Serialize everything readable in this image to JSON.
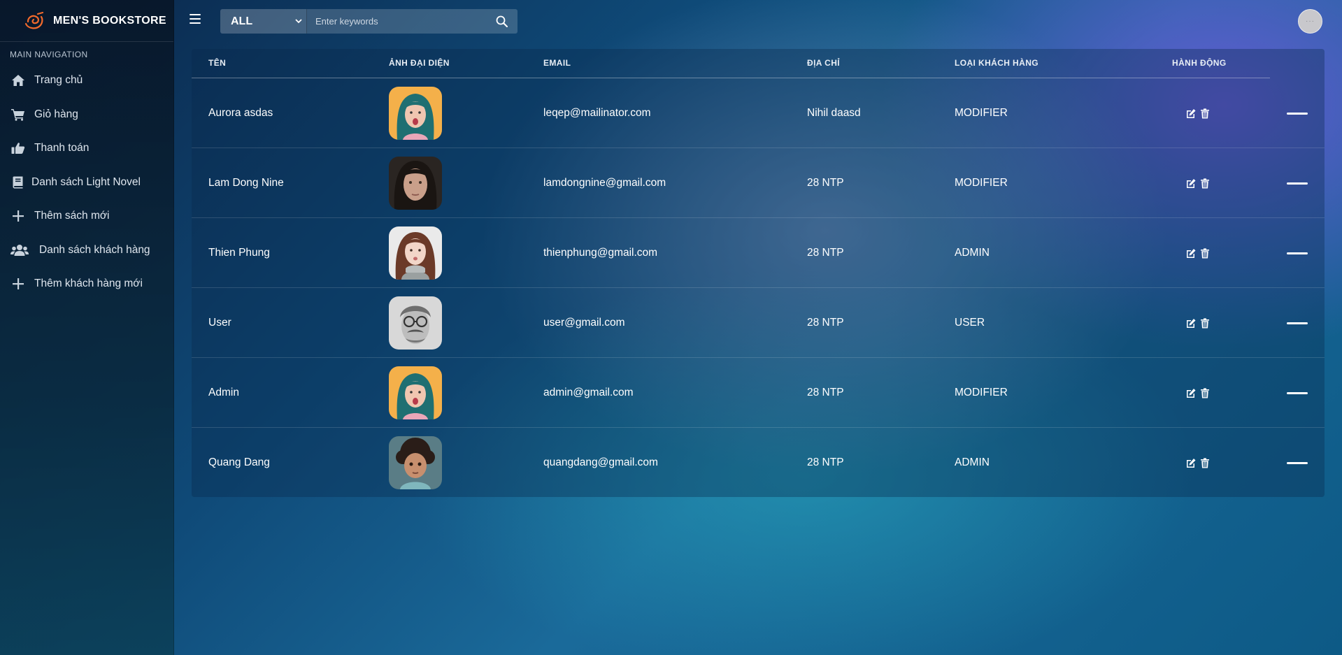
{
  "brand": {
    "title": "MEN'S BOOKSTORE",
    "logo_icon": "swirl-logo-icon",
    "accent": "#f26a2c"
  },
  "sidebar": {
    "header": "MAIN NAVIGATION",
    "items": [
      {
        "label": "Trang chủ",
        "icon": "home-icon"
      },
      {
        "label": "Giỏ hàng",
        "icon": "cart-icon"
      },
      {
        "label": "Thanh toán",
        "icon": "thumbs-up-icon"
      },
      {
        "label": "Danh sách Light Novel",
        "icon": "book-icon"
      },
      {
        "label": "Thêm sách mới",
        "icon": "plus-icon"
      },
      {
        "label": "Danh sách khách hàng",
        "icon": "users-icon"
      },
      {
        "label": "Thêm khách hàng mới",
        "icon": "plus-icon"
      }
    ]
  },
  "topbar": {
    "filter_selected": "ALL",
    "search_placeholder": "Enter keywords"
  },
  "table": {
    "columns": [
      "TÊN",
      "ẢNH ĐẠI DIỆN",
      "EMAIL",
      "ĐỊA CHỈ",
      "LOẠI KHÁCH HÀNG",
      "HÀNH ĐỘNG"
    ],
    "rows": [
      {
        "name": "Aurora asdas",
        "email": "leqep@mailinator.com",
        "address": "Nihil daasd",
        "type": "MODIFIER",
        "avatar": "girl-teal-hair"
      },
      {
        "name": "Lam Dong Nine",
        "email": "lamdongnine@gmail.com",
        "address": "28 NTP",
        "type": "MODIFIER",
        "avatar": "woman-dark-hair"
      },
      {
        "name": "Thien Phung",
        "email": "thienphung@gmail.com",
        "address": "28 NTP",
        "type": "ADMIN",
        "avatar": "woman-brown-hair"
      },
      {
        "name": "User",
        "email": "user@gmail.com",
        "address": "28 NTP",
        "type": "USER",
        "avatar": "man-glasses-bw"
      },
      {
        "name": "Admin",
        "email": "admin@gmail.com",
        "address": "28 NTP",
        "type": "MODIFIER",
        "avatar": "girl-teal-hair"
      },
      {
        "name": "Quang Dang",
        "email": "quangdang@gmail.com",
        "address": "28 NTP",
        "type": "ADMIN",
        "avatar": "child-curly-hair"
      }
    ]
  }
}
